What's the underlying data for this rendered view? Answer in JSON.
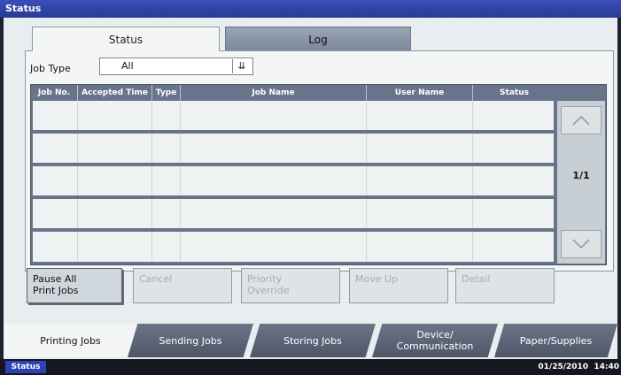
{
  "window": {
    "title": "Status"
  },
  "top_tabs": [
    {
      "label": "Status",
      "active": true
    },
    {
      "label": "Log",
      "active": false
    }
  ],
  "job_type": {
    "label": "Job Type",
    "value": "All",
    "arrow": "double-chevron-down-icon"
  },
  "table": {
    "columns": [
      "Job No.",
      "Accepted Time",
      "Type",
      "Job Name",
      "User Name",
      "Status"
    ],
    "rows": []
  },
  "scroll": {
    "up_icon": "chevron-up-icon",
    "down_icon": "chevron-down-icon",
    "page": "1/1"
  },
  "actions": {
    "pause_all": "Pause All\nPrint Jobs",
    "cancel": "Cancel",
    "priority_override": "Priority\nOverride",
    "move_up": "Move Up",
    "detail": "Detail"
  },
  "bottom_tabs": [
    {
      "label": "Printing Jobs",
      "active": true
    },
    {
      "label": "Sending Jobs",
      "active": false
    },
    {
      "label": "Storing Jobs",
      "active": false
    },
    {
      "label": "Device/\nCommunication",
      "active": false
    },
    {
      "label": "Paper/Supplies",
      "active": false
    }
  ],
  "status_bar": {
    "status_label": "Status",
    "date": "01/25/2010",
    "time": "14:40"
  },
  "colors": {
    "title_bar": "#2a3a92",
    "table_header": "#68748a",
    "tab_inactive": "#4e5668"
  }
}
